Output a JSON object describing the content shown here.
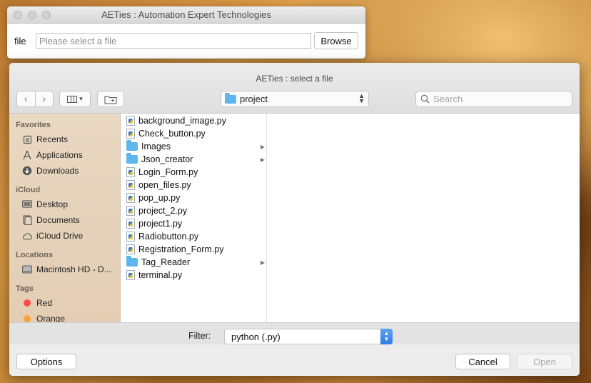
{
  "main_window": {
    "title": "AETies : Automation Expert Technologies",
    "file_label": "file",
    "file_placeholder": "Please select a file",
    "file_value": "",
    "browse_label": "Browse"
  },
  "dialog": {
    "title": "AETies : select a file",
    "nav": {
      "back": "‹",
      "forward": "›"
    },
    "path_label": "project",
    "search_placeholder": "Search",
    "sidebar": {
      "favorites_heading": "Favorites",
      "favorites": [
        {
          "label": "Recents",
          "icon": "recents-icon"
        },
        {
          "label": "Applications",
          "icon": "applications-icon"
        },
        {
          "label": "Downloads",
          "icon": "downloads-icon"
        }
      ],
      "icloud_heading": "iCloud",
      "icloud": [
        {
          "label": "Desktop",
          "icon": "desktop-icon"
        },
        {
          "label": "Documents",
          "icon": "documents-icon"
        },
        {
          "label": "iCloud Drive",
          "icon": "cloud-icon"
        }
      ],
      "locations_heading": "Locations",
      "locations": [
        {
          "label": "Macintosh HD - D...",
          "icon": "disk-icon"
        }
      ],
      "tags_heading": "Tags",
      "tags": [
        {
          "label": "Red",
          "color": "#ff4a47"
        },
        {
          "label": "Orange",
          "color": "#f7a23a"
        }
      ]
    },
    "files": [
      {
        "name": "background_image.py",
        "kind": "file"
      },
      {
        "name": "Check_button.py",
        "kind": "file"
      },
      {
        "name": "Images",
        "kind": "folder"
      },
      {
        "name": "Json_creator",
        "kind": "folder"
      },
      {
        "name": "Login_Form.py",
        "kind": "file"
      },
      {
        "name": "open_files.py",
        "kind": "file"
      },
      {
        "name": "pop_up.py",
        "kind": "file"
      },
      {
        "name": "project_2.py",
        "kind": "file"
      },
      {
        "name": "project1.py",
        "kind": "file"
      },
      {
        "name": "Radiobutton.py",
        "kind": "file"
      },
      {
        "name": "Registration_Form.py",
        "kind": "file"
      },
      {
        "name": "Tag_Reader",
        "kind": "folder"
      },
      {
        "name": "terminal.py",
        "kind": "file"
      }
    ],
    "filter_label": "Filter:",
    "filter_value": "python (.py)",
    "options_label": "Options",
    "cancel_label": "Cancel",
    "open_label": "Open"
  }
}
